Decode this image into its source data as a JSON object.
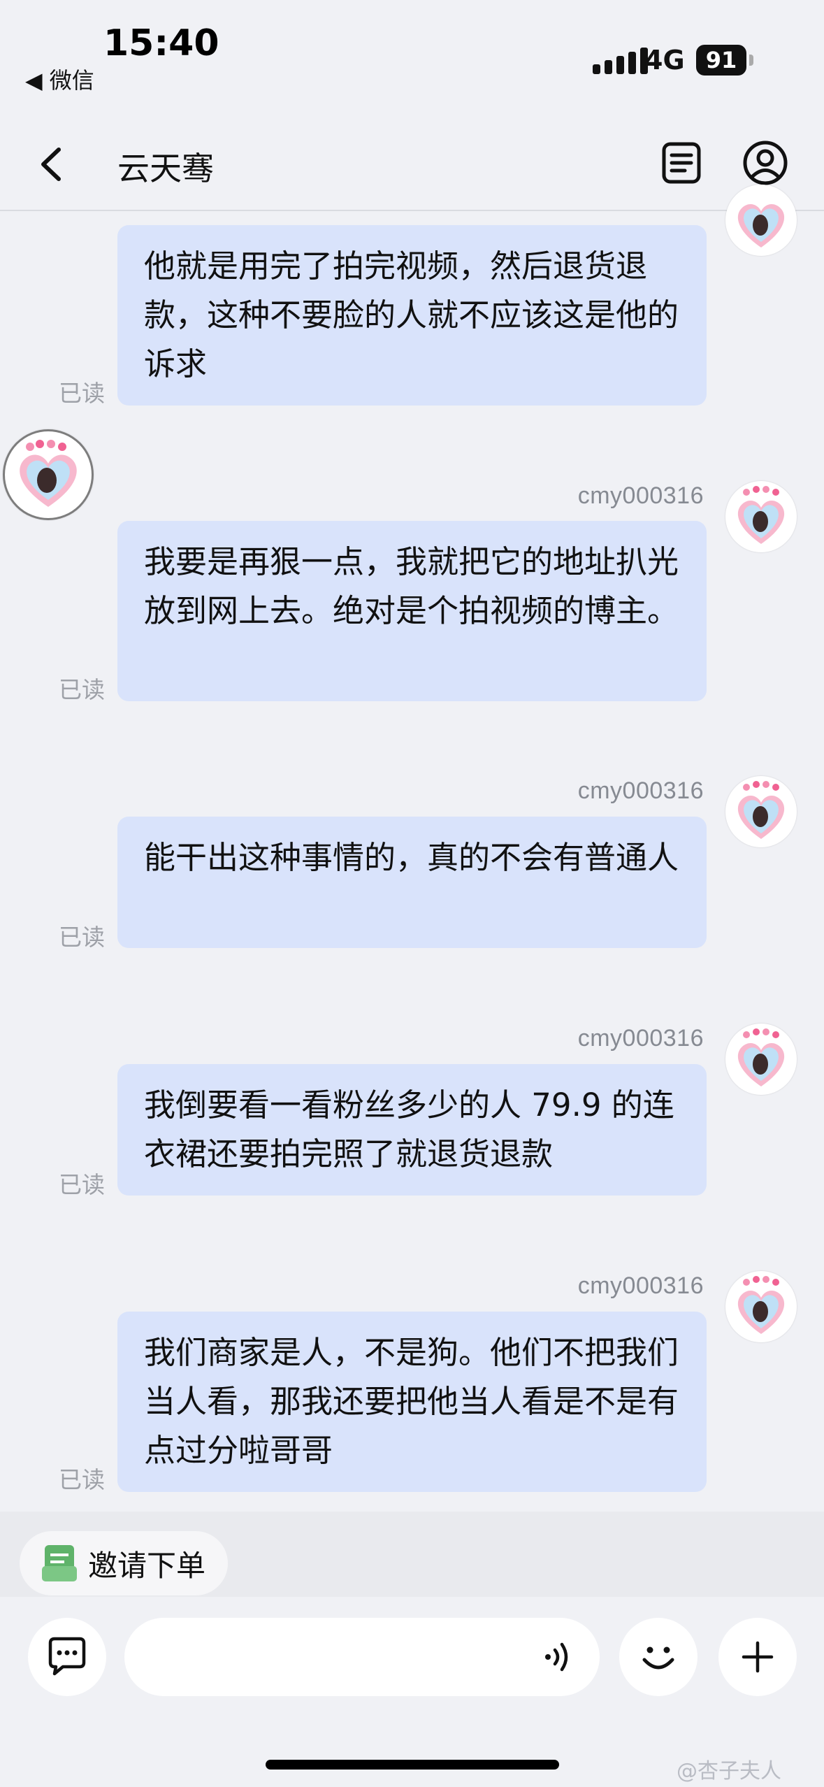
{
  "status_bar": {
    "time": "15:40",
    "back_app": "◀ 微信",
    "network": "4G",
    "battery": "91"
  },
  "header": {
    "title": "云天骞"
  },
  "messages": [
    {
      "sender": "",
      "text": "他就是用完了拍完视频，然后退货退款，这种不要脸的人就不应该这是他的诉求",
      "read": "已读"
    },
    {
      "sender": "cmy000316",
      "text": "我要是再狠一点，我就把它的地址扒光放到网上去。绝对是个拍视频的博主。",
      "read": "已读"
    },
    {
      "sender": "cmy000316",
      "text": "能干出这种事情的，真的不会有普通人",
      "read": "已读"
    },
    {
      "sender": "cmy000316",
      "text": "我倒要看一看粉丝多少的人 79.9 的连衣裙还要拍完照了就退货退款",
      "read": "已读"
    },
    {
      "sender": "cmy000316",
      "text": "我们商家是人，不是狗。他们不把我们当人看，那我还要把他当人看是不是有点过分啦哥哥",
      "read": "已读"
    }
  ],
  "invite": {
    "label": "邀请下单"
  },
  "watermark": "@杏子夫人",
  "icons": {
    "back": "chevron-left-icon",
    "order": "list-document-icon",
    "profile": "user-circle-icon",
    "chat": "chat-bubble-icon",
    "voice": "voice-wave-icon",
    "emoji": "smile-icon",
    "add": "plus-icon",
    "invite": "order-invite-icon"
  },
  "colors": {
    "bubble": "#d9e3fb",
    "background": "#f0f1f5",
    "read": "#9ea1a8",
    "invite_icon": "#5fb36a"
  }
}
